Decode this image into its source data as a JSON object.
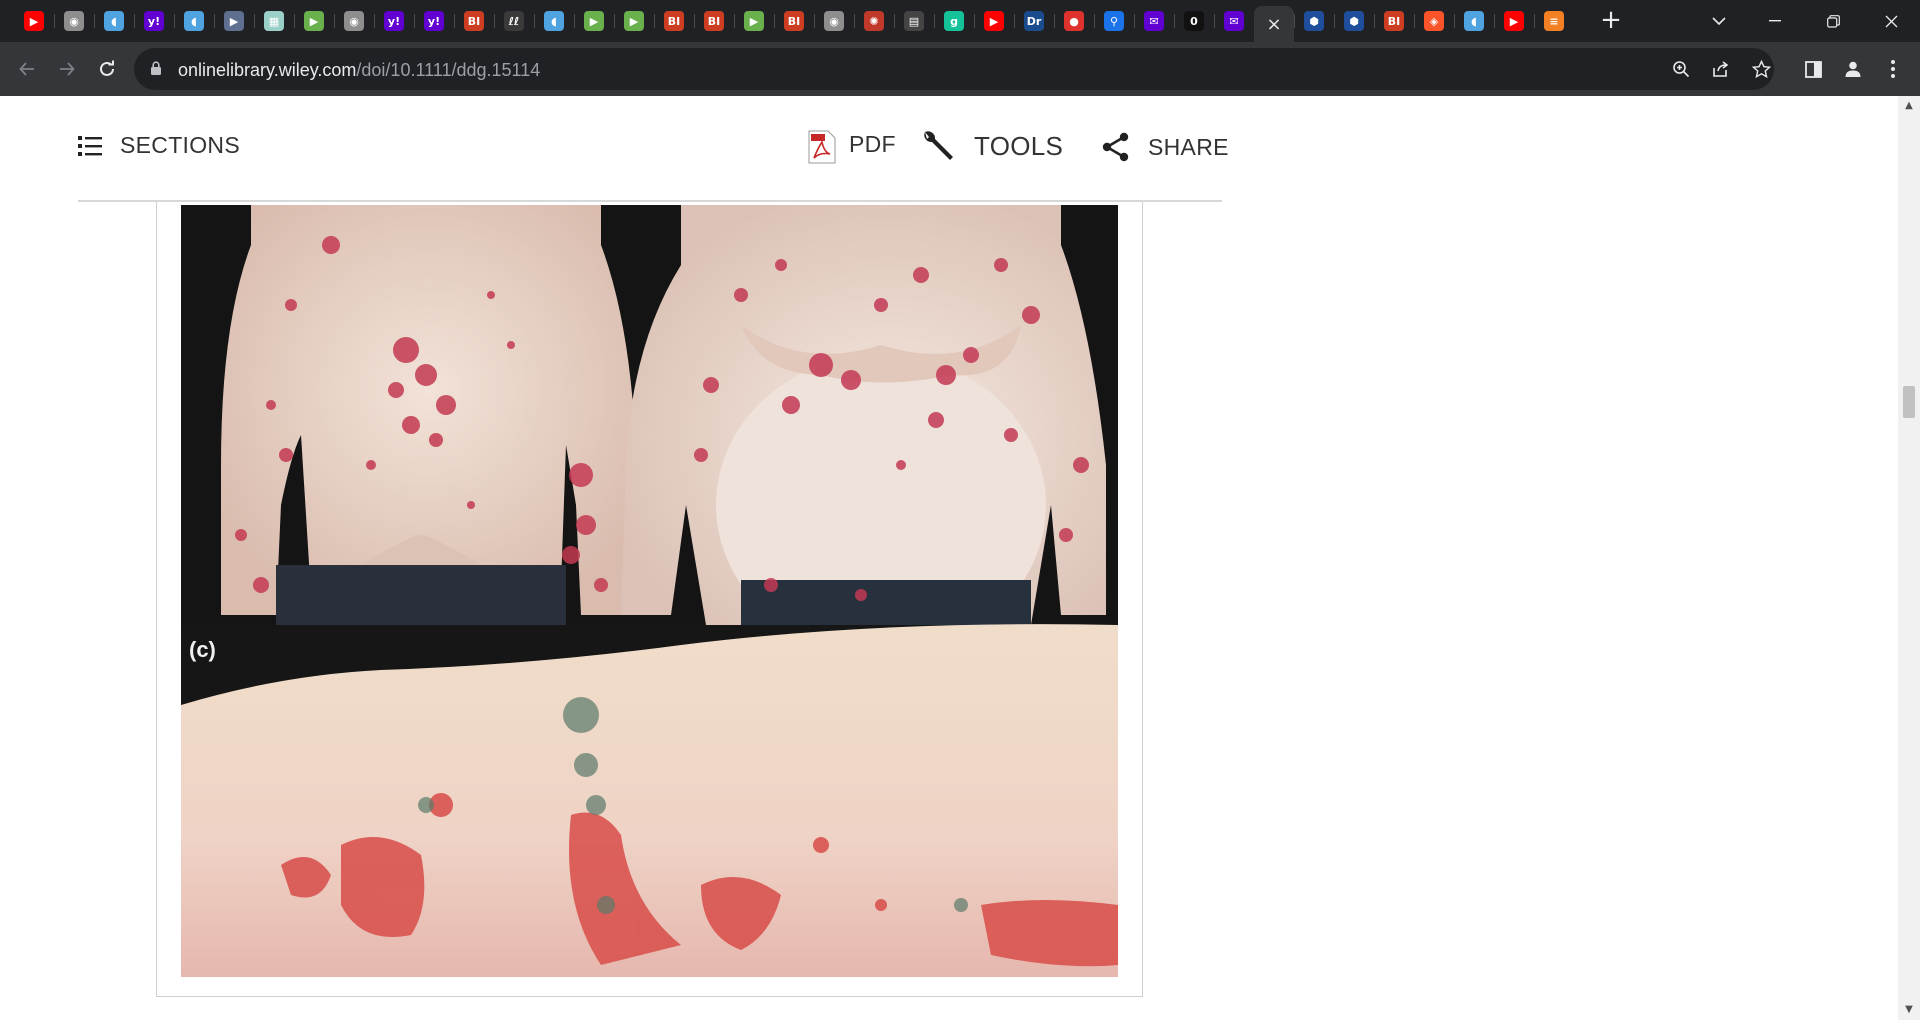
{
  "browser": {
    "tabs": [
      {
        "icon": "youtube-icon",
        "glyph": "▶",
        "color": "#ff0000"
      },
      {
        "icon": "globe-icon",
        "glyph": "◉",
        "color": "#8e8e8e"
      },
      {
        "icon": "shield-icon",
        "glyph": "◖",
        "color": "#4fa3e0"
      },
      {
        "icon": "yahoo-icon",
        "glyph": "y!",
        "color": "#6001d2"
      },
      {
        "icon": "shield-icon",
        "glyph": "◖",
        "color": "#4fa3e0"
      },
      {
        "icon": "bookmark-icon",
        "glyph": "▶",
        "color": "#5f6f8f"
      },
      {
        "icon": "image-icon",
        "glyph": "▦",
        "color": "#9ad0c8"
      },
      {
        "icon": "play-icon",
        "glyph": "▶",
        "color": "#6ab04c"
      },
      {
        "icon": "globe-icon",
        "glyph": "◉",
        "color": "#8e8e8e"
      },
      {
        "icon": "yahoo-icon",
        "glyph": "y!",
        "color": "#6001d2"
      },
      {
        "icon": "yahoo-icon",
        "glyph": "y!",
        "color": "#6001d2"
      },
      {
        "icon": "bi-icon",
        "glyph": "BI",
        "color": "#cc3d21"
      },
      {
        "icon": "handwriting-icon",
        "glyph": "ℓℓ",
        "color": "#3a3a3a"
      },
      {
        "icon": "shield-icon",
        "glyph": "◖",
        "color": "#4fa3e0"
      },
      {
        "icon": "play-icon",
        "glyph": "▶",
        "color": "#6ab04c"
      },
      {
        "icon": "play-icon",
        "glyph": "▶",
        "color": "#6ab04c"
      },
      {
        "icon": "bi-icon",
        "glyph": "BI",
        "color": "#cc3d21"
      },
      {
        "icon": "bi-icon",
        "glyph": "BI",
        "color": "#cc3d21"
      },
      {
        "icon": "play-icon",
        "glyph": "▶",
        "color": "#6ab04c"
      },
      {
        "icon": "bi-icon",
        "glyph": "BI",
        "color": "#cc3d21"
      },
      {
        "icon": "globe-icon",
        "glyph": "◉",
        "color": "#8e8e8e"
      },
      {
        "icon": "burst-icon",
        "glyph": "✺",
        "color": "#c0392b"
      },
      {
        "icon": "news-icon",
        "glyph": "▤",
        "color": "#444444"
      },
      {
        "icon": "grammarly-icon",
        "glyph": "g",
        "color": "#15c39a"
      },
      {
        "icon": "youtube-icon",
        "glyph": "▶",
        "color": "#ff0000"
      },
      {
        "icon": "dr-icon",
        "glyph": "Dr",
        "color": "#1a4b8c"
      },
      {
        "icon": "mic-icon",
        "glyph": "●",
        "color": "#e0322c"
      },
      {
        "icon": "search-icon",
        "glyph": "⚲",
        "color": "#1a73e8"
      },
      {
        "icon": "mail-icon",
        "glyph": "✉",
        "color": "#6001d2"
      },
      {
        "icon": "zero-icon",
        "glyph": "0",
        "color": "#111111"
      },
      {
        "icon": "mail-icon",
        "glyph": "✉",
        "color": "#6001d2"
      },
      {
        "icon": "close-icon",
        "glyph": "×",
        "color": "#35363a",
        "active": true
      },
      {
        "icon": "cube-icon",
        "glyph": "⬢",
        "color": "#1f4e9c"
      },
      {
        "icon": "cube-icon",
        "glyph": "⬢",
        "color": "#1f4e9c"
      },
      {
        "icon": "bi-icon",
        "glyph": "BI",
        "color": "#cc3d21"
      },
      {
        "icon": "brave-icon",
        "glyph": "◈",
        "color": "#fb542b"
      },
      {
        "icon": "shield-icon",
        "glyph": "◖",
        "color": "#4fa3e0"
      },
      {
        "icon": "youtube-icon",
        "glyph": "▶",
        "color": "#ff0000"
      },
      {
        "icon": "stack-icon",
        "glyph": "≡",
        "color": "#f48024"
      }
    ],
    "url_host": "onlinelibrary.wiley.com",
    "url_path": "/doi/10.1111/ddg.15114"
  },
  "article_toolbar": {
    "sections_label": "SECTIONS",
    "pdf_label": "PDF",
    "tools_label": "TOOLS",
    "share_label": "SHARE"
  },
  "figure": {
    "panel_c_label": "(c)"
  }
}
